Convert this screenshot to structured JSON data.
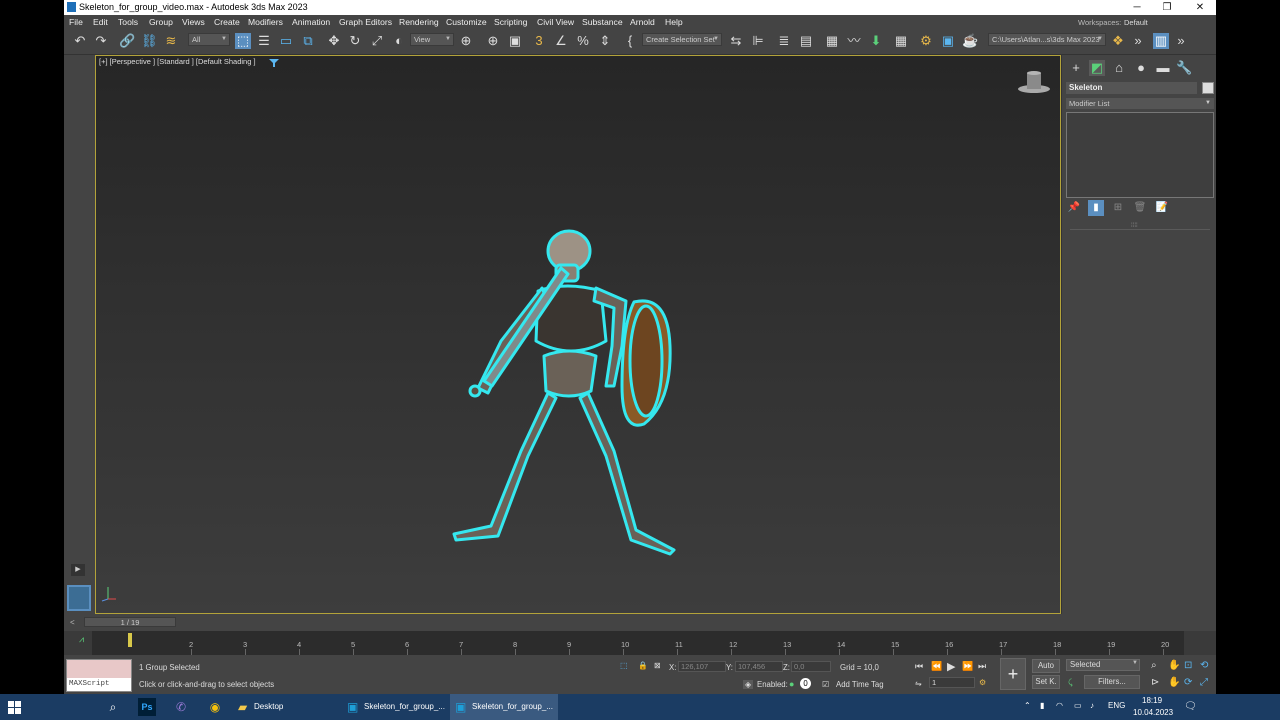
{
  "window": {
    "title": "Skeleton_for_group_video.max - Autodesk 3ds Max 2023",
    "minimize": "─",
    "maximize": "❐",
    "close": "✕"
  },
  "menu": {
    "items": [
      "File",
      "Edit",
      "Tools",
      "Group",
      "Views",
      "Create",
      "Modifiers",
      "Animation",
      "Graph Editors",
      "Rendering",
      "Customize",
      "Scripting",
      "Civil View",
      "Substance",
      "Arnold",
      "Help"
    ],
    "workspaces_label": "Workspaces:",
    "workspace_value": "Default"
  },
  "toolbar": {
    "selection_filter": "All",
    "ref_coord": "View",
    "named_selection": "Create Selection Set",
    "project_path": "C:\\Users\\Atlan...s\\3ds Max 2023",
    "icons": {
      "undo": "↶",
      "redo": "↷",
      "link": "🔗",
      "unlink": "⛓",
      "bind": "≋",
      "select": "⬚",
      "select_by_name": "☰",
      "rect_region": "▭",
      "window_crossing": "⧉",
      "move": "✥",
      "rotate": "↻",
      "scale": "⤢",
      "place": "◐",
      "pivot": "⊕",
      "snaps": "3",
      "angle_snap": "∠",
      "percent_snap": "%",
      "spinner_snap": "⇕",
      "edit_named": "{",
      "mirror": "⇆",
      "align": "⊫",
      "layers": "≣",
      "scene_explorer": "▤",
      "ribbon": "▦",
      "curve_editor": "〰",
      "schematic": "⬇",
      "material_editor": "⚙",
      "render_setup": "❖",
      "render_frame": "▣",
      "render": "☕",
      "more": "»",
      "viewport_layout": "▥"
    }
  },
  "viewport": {
    "label": "[+] [Perspective ] [Standard ] [Default Shading ]",
    "filter_icon": "funnel-icon",
    "expand": "▶"
  },
  "command_panel": {
    "tabs": [
      "+",
      "◩",
      "⌂",
      "●",
      "▬",
      "🔧"
    ],
    "object_name": "Skeleton",
    "modifier_list": "Modifier List",
    "stack_tools": [
      "📌",
      "▮",
      "⊞",
      "🗑",
      "📝"
    ],
    "divider": "⁞⁞⁞⁞"
  },
  "time": {
    "slider": "1 / 19",
    "prev": "<",
    "next": ">",
    "ticks": [
      "2",
      "3",
      "4",
      "5",
      "6",
      "7",
      "8",
      "9",
      "10",
      "11",
      "12",
      "13",
      "14",
      "15",
      "16",
      "17",
      "18",
      "19",
      "20"
    ]
  },
  "status": {
    "maxscript_label": "MAXScript Mini",
    "selection": "1 Group Selected",
    "prompt": "Click or click-and-drag to select objects",
    "x_label": "X:",
    "x_value": "126,107",
    "y_label": "Y:",
    "y_value": "107,456",
    "z_label": "Z:",
    "z_value": "0,0",
    "grid": "Grid = 10,0",
    "enabled": "Enabled:",
    "add_time_tag": "Add Time Tag",
    "auto": "Auto",
    "setk": "Set K.",
    "selected": "Selected",
    "filters": "Filters...",
    "frame": "1"
  },
  "playback": {
    "first": "⏮",
    "prev": "⏪",
    "play": "▶",
    "next": "⏩",
    "last": "⏭"
  },
  "taskbar": {
    "apps": [
      "Desktop",
      "Skeleton_for_group_...",
      "Skeleton_for_group_..."
    ],
    "lang": "ENG",
    "time": "18:19",
    "date": "10.04.2023"
  },
  "colors": {
    "accent": "#5bb6f0",
    "selection_outline": "#35e8ef",
    "viewport_border": "#b3a33a",
    "taskbar": "#1b3c63"
  }
}
